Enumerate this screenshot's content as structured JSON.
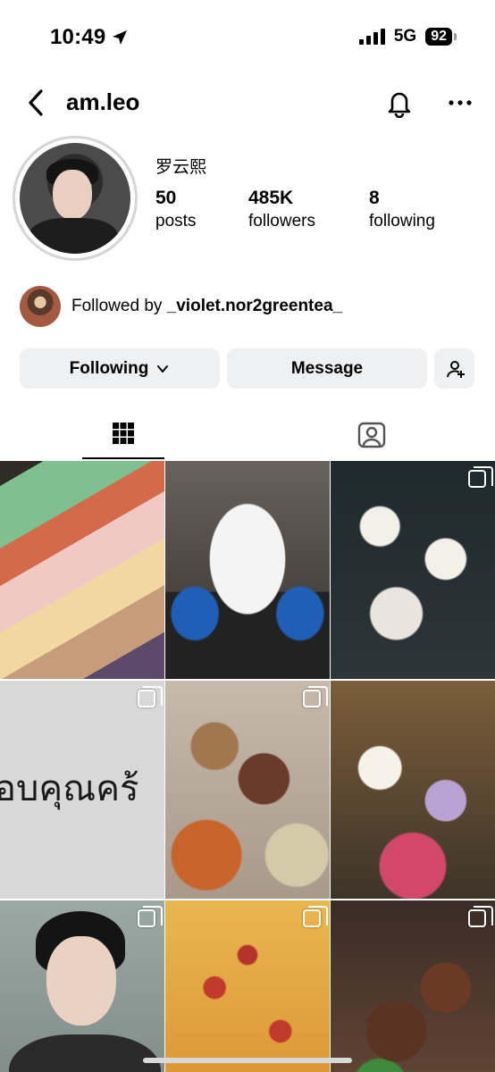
{
  "status_bar": {
    "time": "10:49",
    "network": "5G",
    "battery": "92"
  },
  "header": {
    "username": "am.leo"
  },
  "profile": {
    "display_name": "罗云熙",
    "stats": [
      {
        "value": "50",
        "label": "posts"
      },
      {
        "value": "485K",
        "label": "followers"
      },
      {
        "value": "8",
        "label": "following"
      }
    ],
    "followed_by_prefix": "Followed by ",
    "followed_by_user": "_violet.nor2greentea_"
  },
  "buttons": {
    "following": "Following",
    "message": "Message"
  },
  "grid": {
    "post_text": "อบคุณคร้"
  },
  "icons": {
    "location_arrow": "location-arrow-icon",
    "back": "chevron-left-icon",
    "bell": "bell-icon",
    "more": "more-horizontal-icon",
    "chevron_down": "chevron-down-icon",
    "add_user": "add-user-icon",
    "grid": "grid-icon",
    "tagged": "tagged-person-icon",
    "multi": "carousel-multi-icon"
  }
}
